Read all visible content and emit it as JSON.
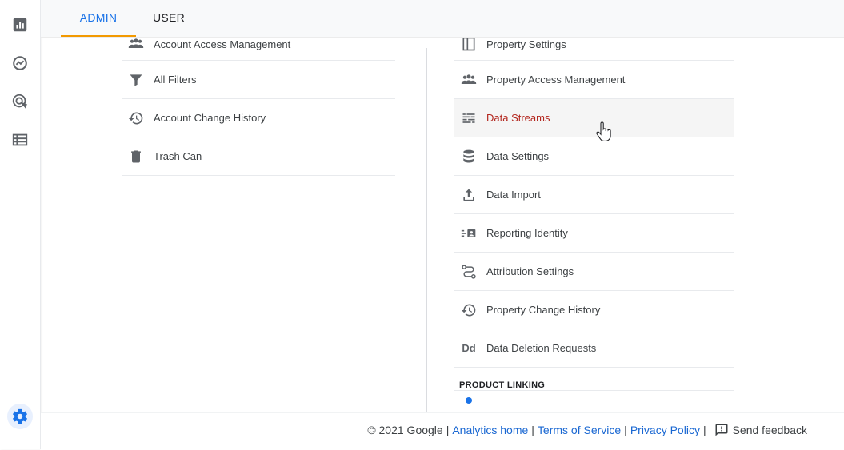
{
  "tabs": {
    "admin": "ADMIN",
    "user": "USER"
  },
  "rail": {
    "items": [
      {
        "name": "reports-icon"
      },
      {
        "name": "explore-icon"
      },
      {
        "name": "advertising-icon"
      },
      {
        "name": "configure-icon"
      }
    ],
    "admin": {
      "name": "admin-gear-icon"
    }
  },
  "account_column": {
    "items": [
      {
        "label": "Account Access Management",
        "icon": "people-icon"
      },
      {
        "label": "All Filters",
        "icon": "filter-icon"
      },
      {
        "label": "Account Change History",
        "icon": "history-icon"
      },
      {
        "label": "Trash Can",
        "icon": "trash-icon"
      }
    ]
  },
  "property_column": {
    "items": [
      {
        "label": "Property Settings",
        "icon": "property-icon"
      },
      {
        "label": "Property Access Management",
        "icon": "people-icon"
      },
      {
        "label": "Data Streams",
        "icon": "data-streams-icon"
      },
      {
        "label": "Data Settings",
        "icon": "database-icon"
      },
      {
        "label": "Data Import",
        "icon": "upload-icon"
      },
      {
        "label": "Reporting Identity",
        "icon": "reporting-identity-icon"
      },
      {
        "label": "Attribution Settings",
        "icon": "attribution-icon"
      },
      {
        "label": "Property Change History",
        "icon": "history-icon"
      },
      {
        "label": "Data Deletion Requests",
        "icon": "dd-icon"
      }
    ],
    "section_heading": "PRODUCT LINKING",
    "dd_glyph": "Dd"
  },
  "footer": {
    "copyright": "© 2021 Google",
    "sep": "|",
    "analytics_home": "Analytics home",
    "terms": "Terms of Service",
    "privacy": "Privacy Policy",
    "feedback": "Send feedback"
  },
  "colors": {
    "accent": "#1a73e8",
    "tab_underline": "#f29900",
    "hover_text": "#b3261e"
  }
}
